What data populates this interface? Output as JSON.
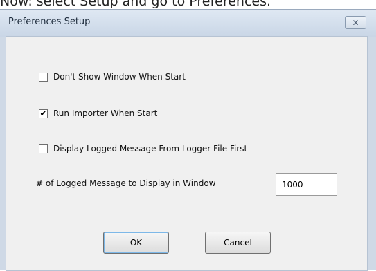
{
  "instruction": "Now: select Setup and go to Preferences.",
  "window": {
    "title": "Preferences Setup",
    "close_glyph": "✕"
  },
  "options": [
    {
      "label": "Don't Show Window When Start",
      "checked": false
    },
    {
      "label": "Run Importer When Start",
      "checked": true
    },
    {
      "label": "Display Logged Message From Logger File First",
      "checked": false
    }
  ],
  "message_count": {
    "label": "# of Logged Message to Display in Window",
    "value": "1000"
  },
  "buttons": {
    "ok_label": "OK",
    "cancel_label": "Cancel"
  },
  "colors": {
    "window_frame": "#cfd9e6",
    "client_bg": "#f0f0f0"
  }
}
